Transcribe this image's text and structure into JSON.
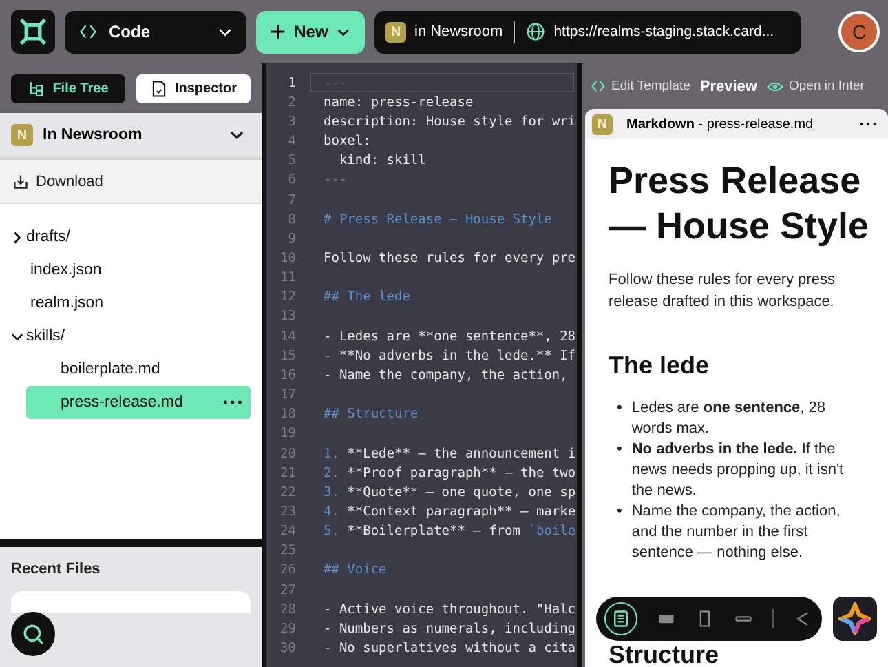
{
  "topbar": {
    "mode": "Code",
    "new_button": "New",
    "realm_badge": "N",
    "realm": "in Newsroom",
    "url": "https://realms-staging.stack.card...",
    "avatar": "C"
  },
  "sidebar": {
    "tabs": [
      {
        "label": "File Tree",
        "selected": true
      },
      {
        "label": "Inspector",
        "selected": false
      }
    ],
    "realm_badge": "N",
    "realm": "In Newsroom",
    "download": "Download",
    "tree": [
      {
        "label": "drafts/",
        "kind": "folder",
        "expanded": false,
        "selected": false
      },
      {
        "label": "index.json",
        "kind": "file",
        "selected": false
      },
      {
        "label": "realm.json",
        "kind": "file",
        "selected": false
      },
      {
        "label": "skills/",
        "kind": "folder",
        "expanded": true,
        "selected": false,
        "children": [
          {
            "label": "boilerplate.md",
            "selected": false
          },
          {
            "label": "press-release.md",
            "selected": true
          }
        ]
      }
    ],
    "recent_title": "Recent Files"
  },
  "editor": {
    "lines": [
      {
        "n": "1",
        "text": "---",
        "kind": "dim",
        "current": true
      },
      {
        "n": "2",
        "text": "name: press-release",
        "kind": "plain",
        "current": false
      },
      {
        "n": "3",
        "text": "description: House style for wri",
        "kind": "plain",
        "current": false
      },
      {
        "n": "4",
        "text": "boxel:",
        "kind": "plain",
        "current": false
      },
      {
        "n": "5",
        "text": "  kind: skill",
        "kind": "plain",
        "current": false
      },
      {
        "n": "6",
        "text": "---",
        "kind": "dim",
        "current": false
      },
      {
        "n": "7",
        "current": false
      },
      {
        "n": "8",
        "text": "# Press Release — House Style",
        "kind": "heading",
        "current": false
      },
      {
        "n": "9",
        "current": false
      },
      {
        "n": "10",
        "text": "Follow these rules for every pre",
        "kind": "plain",
        "current": false
      },
      {
        "n": "11",
        "current": false
      },
      {
        "n": "12",
        "text": "## The lede",
        "kind": "heading",
        "current": false
      },
      {
        "n": "13",
        "current": false
      },
      {
        "n": "14",
        "text": "- Ledes are **one sentence**, 28",
        "kind": "plain",
        "current": false
      },
      {
        "n": "15",
        "text": "- **No adverbs in the lede.** If",
        "kind": "plain",
        "current": false
      },
      {
        "n": "16",
        "text": "- Name the company, the action,",
        "kind": "plain",
        "current": false
      },
      {
        "n": "17",
        "current": false
      },
      {
        "n": "18",
        "text": "## Structure",
        "kind": "heading",
        "current": false
      },
      {
        "n": "19",
        "current": false
      },
      {
        "n": "20",
        "marker": "1.",
        "text": " **Lede** — the announcement i",
        "kind": "plain",
        "current": false
      },
      {
        "n": "21",
        "marker": "2.",
        "text": " **Proof paragraph** — the two",
        "kind": "plain",
        "current": false
      },
      {
        "n": "22",
        "marker": "3.",
        "text": " **Quote** — one quote, one sp",
        "kind": "plain",
        "current": false
      },
      {
        "n": "23",
        "marker": "4.",
        "text": " **Context paragraph** — marke",
        "kind": "plain",
        "current": false
      },
      {
        "n": "24",
        "marker": "5.",
        "text": " **Boilerplate** — from ",
        "code": "`boile",
        "kind": "plain",
        "current": false
      },
      {
        "n": "25",
        "current": false
      },
      {
        "n": "26",
        "text": "## Voice",
        "kind": "heading",
        "current": false
      },
      {
        "n": "27",
        "current": false
      },
      {
        "n": "28",
        "text": "- Active voice throughout. \"Halc",
        "kind": "plain",
        "current": false
      },
      {
        "n": "29",
        "text": "- Numbers as numerals, including",
        "kind": "plain",
        "current": false
      },
      {
        "n": "30",
        "text": "- No superlatives without a cita",
        "kind": "plain",
        "current": false
      }
    ]
  },
  "preview": {
    "tabs": [
      {
        "label": "Edit Template",
        "selected": false
      },
      {
        "label": "Preview",
        "selected": true
      },
      {
        "label": "Open in Inter",
        "selected": false
      }
    ],
    "card_badge": "N",
    "card_title": "Markdown",
    "card_file": " - press-release.md",
    "h1": "Press Release — House Style",
    "intro": "Follow these rules for every press release drafted in this workspace.",
    "h2": "The lede",
    "bullets": [
      {
        "marker": "•",
        "text": "Ledes are **one sentence**, 28 words max."
      },
      {
        "marker": "•",
        "text": "**No adverbs in the lede.** If the news needs propping up, it isn't the news."
      },
      {
        "marker": "•",
        "text": "Name the company, the action, and the number in the first sentence — nothing else."
      }
    ],
    "h2_next": "Structure"
  }
}
